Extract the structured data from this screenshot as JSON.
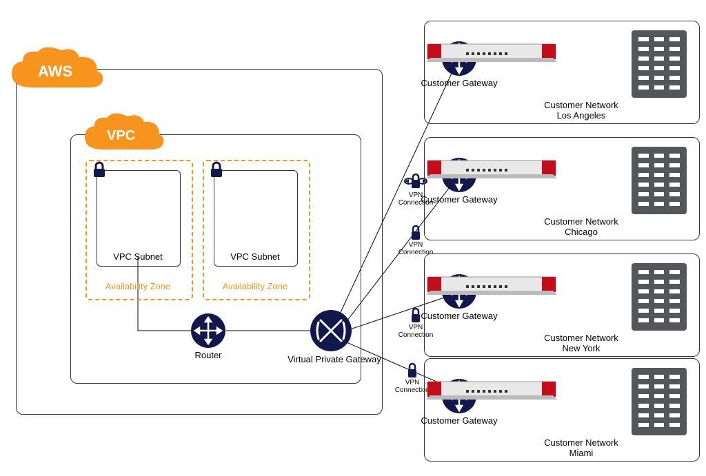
{
  "aws": {
    "cloud_label": "AWS"
  },
  "vpc": {
    "cloud_label": "VPC",
    "subnets": [
      {
        "name": "VPC Subnet",
        "az": "Availability Zone"
      },
      {
        "name": "VPC Subnet",
        "az": "Availability Zone"
      }
    ],
    "router_label": "Router",
    "vpg_label": "Virtual Private Gateway"
  },
  "connections": [
    {
      "vpn_label": "VPN\nConnection",
      "cgw_label": "Customer Gateway",
      "network_label": "Customer Network\nLos Angeles"
    },
    {
      "vpn_label": "VPN\nConnection",
      "cgw_label": "Customer Gateway",
      "network_label": "Customer Network\nChicago"
    },
    {
      "vpn_label": "VPN\nConnection",
      "cgw_label": "Customer Gateway",
      "network_label": "Customer Network\nNew York"
    },
    {
      "vpn_label": "VPN\nConnection",
      "cgw_label": "Customer Gateway",
      "network_label": "Customer Network\nMiami"
    }
  ],
  "colors": {
    "orange": "#F7941D",
    "navy": "#13184C",
    "gray": "#55565A",
    "red": "#C20E1A"
  }
}
